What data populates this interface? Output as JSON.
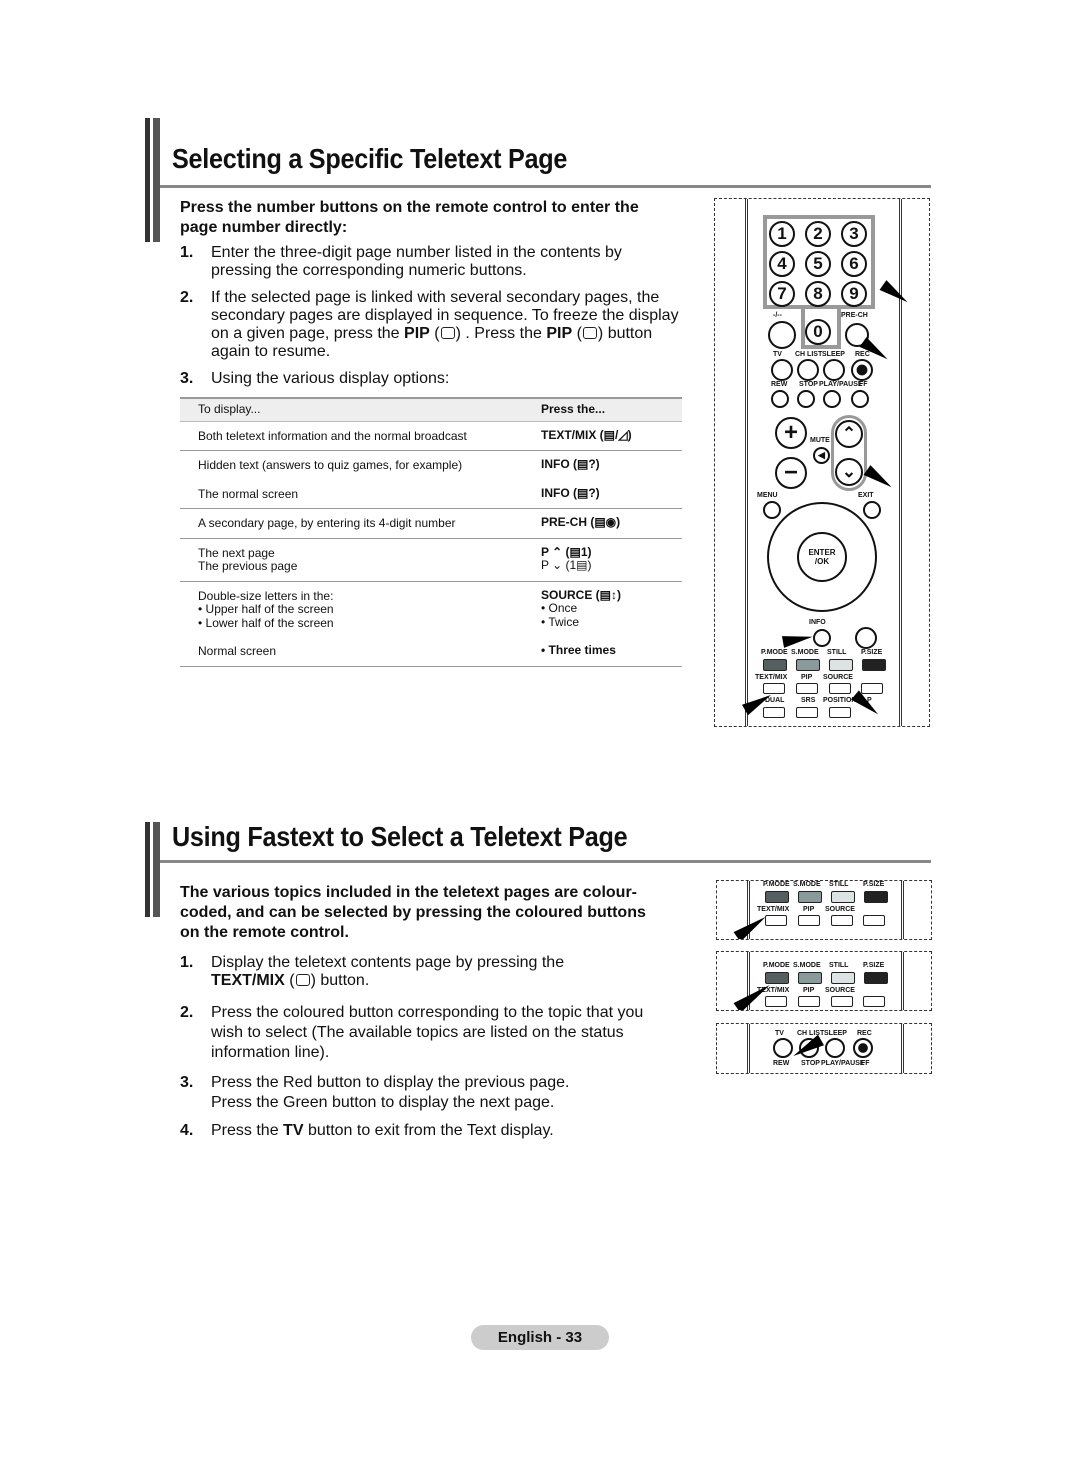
{
  "section1": {
    "title": "Selecting a Specific Teletext Page",
    "intro": "Press the number buttons on the remote control to enter the page number directly:",
    "items": [
      {
        "num": "1.",
        "text": "Enter the three-digit page number listed in the contents by pressing the corresponding numeric buttons."
      },
      {
        "num": "2.",
        "text_a": "If the selected page is linked with several secondary pages, the secondary pages are displayed in sequence. To freeze the display on a given page, press the",
        "key1": "PIP",
        "text_b": ". Press the",
        "key2": "PIP",
        "text_c": "button again to resume."
      },
      {
        "num": "3.",
        "text": "Using the various display options:"
      }
    ],
    "table": {
      "headers": [
        "To display...",
        "Press the..."
      ],
      "rows": [
        {
          "display": [
            "Both teletext information and the normal broadcast"
          ],
          "press": [
            "TEXT/MIX (▤/◿)"
          ]
        },
        {
          "display": [
            "Hidden text (answers to quiz games, for example)"
          ],
          "press": [
            "INFO (▤?)"
          ],
          "nodivider": true
        },
        {
          "display": [
            "The normal screen"
          ],
          "press": [
            "INFO (▤?)"
          ]
        },
        {
          "display": [
            "A secondary page, by entering its 4-digit number"
          ],
          "press": [
            "PRE-CH (▤◉)"
          ]
        },
        {
          "display": [
            "The next page",
            "The previous page"
          ],
          "press": [
            "P ⌃ (▤1)",
            "P ⌄ (1▤)"
          ]
        },
        {
          "display": [
            "Double-size letters in the:",
            "• Upper half of the screen",
            "• Lower half of the screen"
          ],
          "press": [
            "SOURCE (▤↕)",
            "• Once",
            "• Twice"
          ],
          "nodivider": true
        },
        {
          "display": [
            "Normal screen"
          ],
          "press": [
            "• Three times"
          ]
        }
      ]
    }
  },
  "section2": {
    "title": "Using Fastext to Select a Teletext Page",
    "intro": "The various topics included in the teletext pages are colour-coded, and can be selected by pressing the coloured buttons on the remote control.",
    "items": [
      {
        "num": "1.",
        "text_a": "Display the teletext contents page by pressing the",
        "key": "TEXT/MIX",
        "text_b": "button."
      },
      {
        "num": "2.",
        "text": "Press the coloured button corresponding to the topic that you wish to select (The available topics are listed on the status information line)."
      },
      {
        "num": "3.",
        "line1": "Press the Red button to display the previous page.",
        "line2": "Press the Green button to display the next page."
      },
      {
        "num": "4.",
        "text_a": "Press the",
        "key": "TV",
        "text_b": "button to exit from the Text display."
      }
    ]
  },
  "remote": {
    "digits": [
      "1",
      "2",
      "3",
      "4",
      "5",
      "6",
      "7",
      "8",
      "9",
      "0"
    ],
    "labels": {
      "dash": "-/--",
      "prech": "PRE-CH",
      "tv": "TV",
      "chlist": "CH LIST",
      "sleep": "SLEEP",
      "rec": "REC",
      "rew": "REW",
      "stop": "STOP",
      "play": "PLAY/PAUSE",
      "ff": "FF",
      "mute": "MUTE",
      "menu": "MENU",
      "exit": "EXIT",
      "enter": "ENTER",
      "ok": "/OK",
      "info": "INFO",
      "pmode": "P.MODE",
      "smode": "S.MODE",
      "still": "STILL",
      "psize": "P.SIZE",
      "textmix": "TEXT/MIX",
      "pip": "PIP",
      "source": "SOURCE",
      "dual": "DUAL",
      "srs": "SRS",
      "position": "POSITION",
      "p": "P"
    },
    "colors": {
      "red_key": "#555f5f",
      "green_key": "#8a9a9a",
      "yellow_key": "#dde3e3",
      "blue_key": "#222222",
      "highlight": "#999999"
    }
  },
  "footer": {
    "page_label": "English - 33"
  }
}
